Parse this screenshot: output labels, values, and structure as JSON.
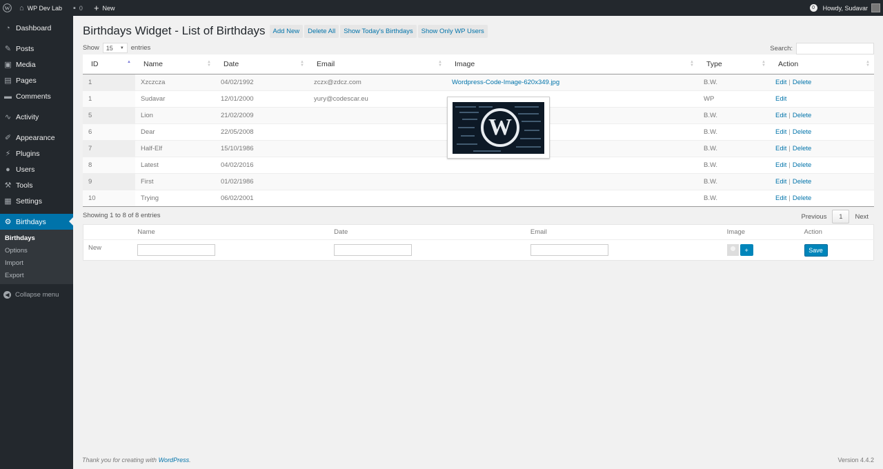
{
  "adminbar": {
    "site_name": "WP Dev Lab",
    "comments_count": "0",
    "new_label": "New",
    "notifications": "0",
    "howdy": "Howdy, Sudavar"
  },
  "sidebar": {
    "items": [
      {
        "label": "Dashboard",
        "icon": "dashboard-icon"
      },
      {
        "label": "Posts",
        "icon": "pin-icon"
      },
      {
        "label": "Media",
        "icon": "media-icon"
      },
      {
        "label": "Pages",
        "icon": "pages-icon"
      },
      {
        "label": "Comments",
        "icon": "comment-icon"
      },
      {
        "label": "Activity",
        "icon": "activity-icon"
      },
      {
        "label": "Appearance",
        "icon": "brush-icon"
      },
      {
        "label": "Plugins",
        "icon": "plug-icon"
      },
      {
        "label": "Users",
        "icon": "users-icon"
      },
      {
        "label": "Tools",
        "icon": "wrench-icon"
      },
      {
        "label": "Settings",
        "icon": "settings-icon"
      },
      {
        "label": "Birthdays",
        "icon": "gear-icon"
      }
    ],
    "submenu": [
      "Birthdays",
      "Options",
      "Import",
      "Export"
    ],
    "collapse": "Collapse menu"
  },
  "page": {
    "title": "Birthdays Widget - List of Birthdays",
    "actions": [
      "Add New",
      "Delete All",
      "Show Today's Birthdays",
      "Show Only WP Users"
    ],
    "show_label": "Show",
    "entries_value": "15",
    "entries_label": "entries",
    "search_label": "Search:",
    "info": "Showing 1 to 8 of 8 entries",
    "previous": "Previous",
    "current_page": "1",
    "next": "Next"
  },
  "table": {
    "columns": [
      "ID",
      "Name",
      "Date",
      "Email",
      "Image",
      "Type",
      "Action"
    ],
    "rows": [
      {
        "id": "1",
        "name": "Xzczcza",
        "date": "04/02/1992",
        "email": "zczx@zdcz.com",
        "image": "Wordpress-Code-Image-620x349.jpg",
        "type": "B.W.",
        "edit": "Edit",
        "delete": "Delete"
      },
      {
        "id": "1",
        "name": "Sudavar",
        "date": "12/01/2000",
        "email": "yury@codescar.eu",
        "image": "",
        "type": "WP",
        "edit": "Edit",
        "delete": ""
      },
      {
        "id": "5",
        "name": "Lion",
        "date": "21/02/2009",
        "email": "",
        "image": "",
        "type": "B.W.",
        "edit": "Edit",
        "delete": "Delete"
      },
      {
        "id": "6",
        "name": "Dear",
        "date": "22/05/2008",
        "email": "",
        "image": "",
        "type": "B.W.",
        "edit": "Edit",
        "delete": "Delete"
      },
      {
        "id": "7",
        "name": "Half-Elf",
        "date": "15/10/1986",
        "email": "",
        "image": "",
        "type": "B.W.",
        "edit": "Edit",
        "delete": "Delete"
      },
      {
        "id": "8",
        "name": "Latest",
        "date": "04/02/2016",
        "email": "",
        "image": "",
        "type": "B.W.",
        "edit": "Edit",
        "delete": "Delete"
      },
      {
        "id": "9",
        "name": "First",
        "date": "01/02/1986",
        "email": "",
        "image": "",
        "type": "B.W.",
        "edit": "Edit",
        "delete": "Delete"
      },
      {
        "id": "10",
        "name": "Trying",
        "date": "06/02/2001",
        "email": "",
        "image": "",
        "type": "B.W.",
        "edit": "Edit",
        "delete": "Delete"
      }
    ]
  },
  "new_row": {
    "columns": [
      "Name",
      "Date",
      "Email",
      "Image",
      "Action"
    ],
    "label": "New",
    "plus": "+",
    "save": "Save"
  },
  "footer": {
    "thanks_prefix": "Thank you for creating with ",
    "thanks_link": "WordPress",
    "thanks_suffix": ".",
    "version": "Version 4.4.2"
  },
  "colors": {
    "sidebar_bg": "#23282d",
    "accent": "#0073aa",
    "button_primary": "#0085ba"
  }
}
